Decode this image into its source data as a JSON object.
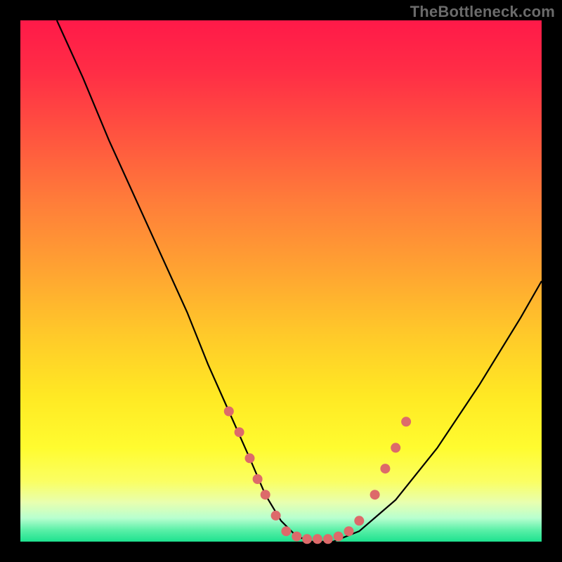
{
  "watermark": {
    "text": "TheBottleneck.com"
  },
  "colors": {
    "black": "#000000",
    "curve": "#000000",
    "dot": "#dd6a6a",
    "gradient_stops": [
      {
        "offset": 0.0,
        "color": "#ff1a49"
      },
      {
        "offset": 0.1,
        "color": "#ff2e46"
      },
      {
        "offset": 0.22,
        "color": "#ff5440"
      },
      {
        "offset": 0.35,
        "color": "#ff7e3a"
      },
      {
        "offset": 0.48,
        "color": "#ffa432"
      },
      {
        "offset": 0.6,
        "color": "#ffc92a"
      },
      {
        "offset": 0.72,
        "color": "#ffe924"
      },
      {
        "offset": 0.82,
        "color": "#fffc30"
      },
      {
        "offset": 0.885,
        "color": "#fbff64"
      },
      {
        "offset": 0.925,
        "color": "#e8ffb0"
      },
      {
        "offset": 0.955,
        "color": "#b8ffd0"
      },
      {
        "offset": 0.978,
        "color": "#5af0a8"
      },
      {
        "offset": 1.0,
        "color": "#1ee28f"
      }
    ]
  },
  "chart_data": {
    "type": "line",
    "title": "",
    "xlabel": "",
    "ylabel": "",
    "xlim": [
      0,
      100
    ],
    "ylim": [
      0,
      100
    ],
    "series": [
      {
        "name": "bottleneck-curve",
        "x": [
          7,
          12,
          17,
          22,
          27,
          32,
          36,
          40,
          44,
          47,
          50,
          53,
          56,
          60,
          65,
          72,
          80,
          88,
          96,
          100
        ],
        "y": [
          100,
          89,
          77,
          66,
          55,
          44,
          34,
          25,
          16,
          9,
          4,
          1,
          0,
          0,
          2,
          8,
          18,
          30,
          43,
          50
        ]
      }
    ],
    "annotations": {
      "dots_left": [
        {
          "x": 40,
          "y": 25
        },
        {
          "x": 42,
          "y": 21
        },
        {
          "x": 44,
          "y": 16
        },
        {
          "x": 45.5,
          "y": 12
        },
        {
          "x": 47,
          "y": 9
        },
        {
          "x": 49,
          "y": 5
        }
      ],
      "dots_bottom": [
        {
          "x": 51,
          "y": 2
        },
        {
          "x": 53,
          "y": 1
        },
        {
          "x": 55,
          "y": 0.5
        },
        {
          "x": 57,
          "y": 0.5
        },
        {
          "x": 59,
          "y": 0.5
        },
        {
          "x": 61,
          "y": 1
        }
      ],
      "dots_right": [
        {
          "x": 63,
          "y": 2
        },
        {
          "x": 65,
          "y": 4
        },
        {
          "x": 68,
          "y": 9
        },
        {
          "x": 70,
          "y": 14
        },
        {
          "x": 72,
          "y": 18
        },
        {
          "x": 74,
          "y": 23
        }
      ]
    }
  }
}
